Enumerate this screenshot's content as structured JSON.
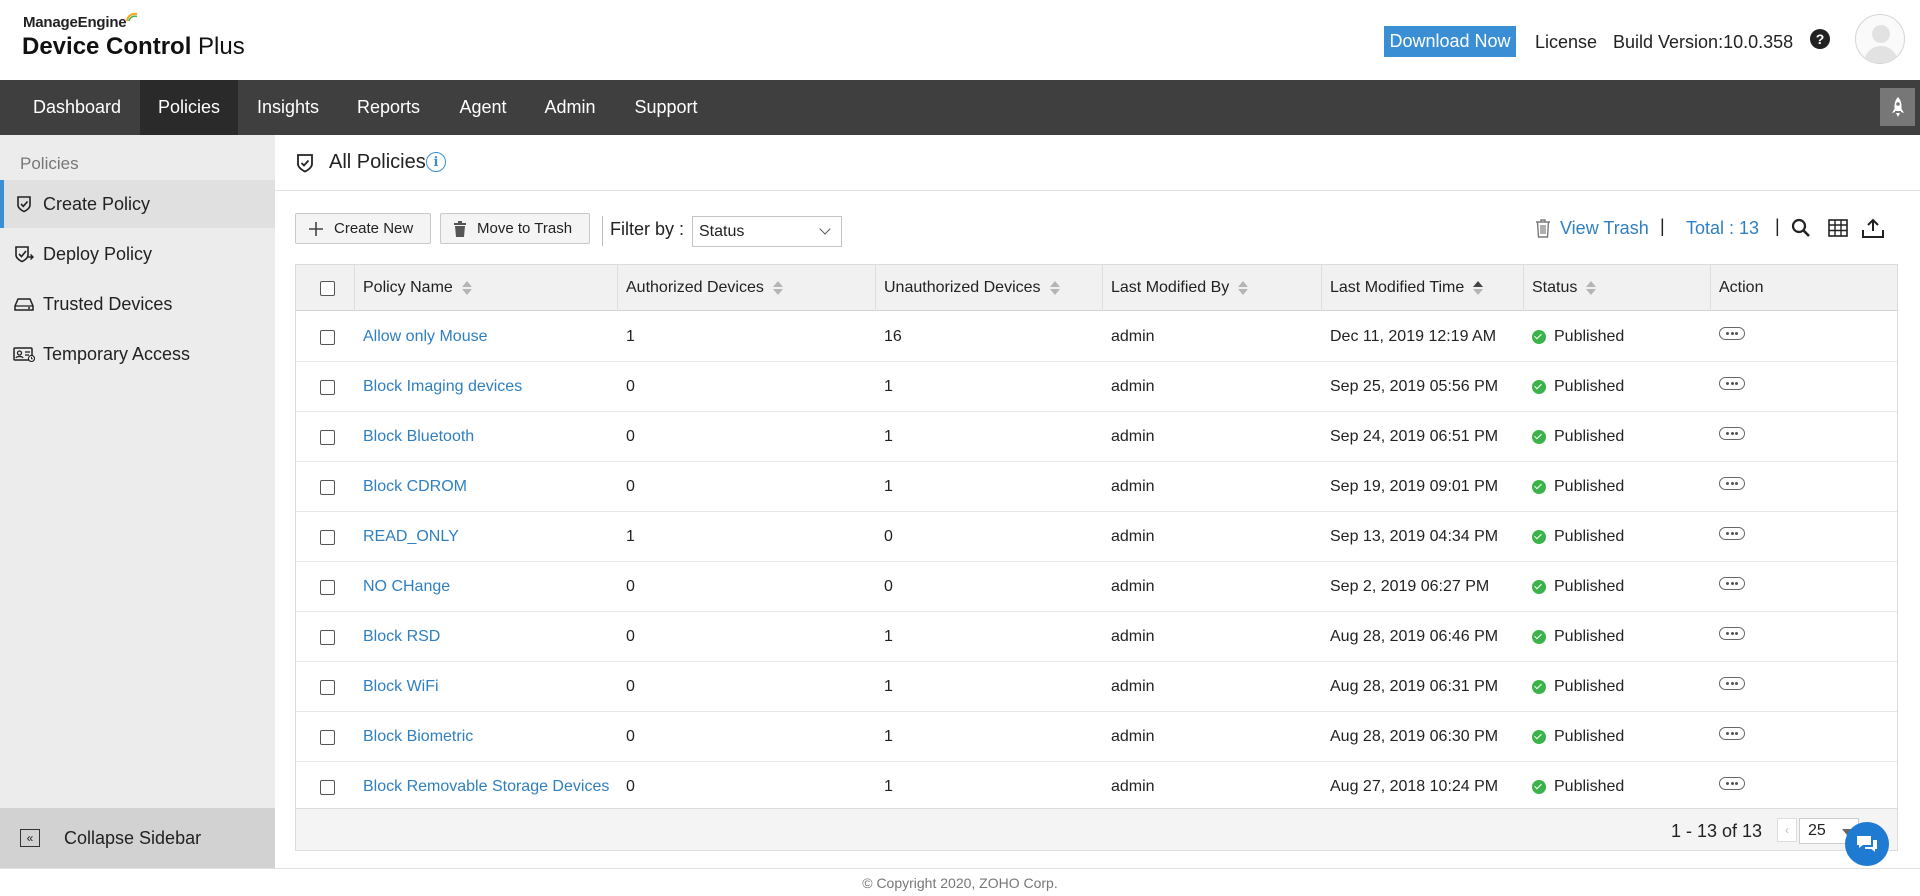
{
  "brand": {
    "top": "ManageEngine",
    "main_bold": "Device Control",
    "main_light": " Plus"
  },
  "header": {
    "download_label": "Download Now",
    "license_label": "License",
    "build_version": "Build Version:10.0.358",
    "help_icon": "question-circle-icon",
    "avatar_icon": "user-avatar-icon"
  },
  "nav": {
    "items": [
      "Dashboard",
      "Policies",
      "Insights",
      "Reports",
      "Agent",
      "Admin",
      "Support"
    ],
    "active": "Policies",
    "rocket_icon": "rocket-icon"
  },
  "sidebar": {
    "title": "Policies",
    "items": [
      {
        "label": "Create Policy",
        "icon": "shield-check-icon"
      },
      {
        "label": "Deploy Policy",
        "icon": "deploy-check-icon"
      },
      {
        "label": "Trusted Devices",
        "icon": "drive-icon"
      },
      {
        "label": "Temporary Access",
        "icon": "access-card-icon"
      }
    ],
    "active": "Create Policy",
    "collapse_label": "Collapse Sidebar"
  },
  "main": {
    "title": "All Policies",
    "create_new_label": "Create New",
    "move_to_trash_label": "Move to Trash",
    "filter_label": "Filter by :",
    "filter_value": "Status",
    "view_trash_label": "View Trash",
    "total_label": "Total : 13",
    "separator": "|"
  },
  "table": {
    "columns": [
      "Policy Name",
      "Authorized Devices",
      "Unauthorized Devices",
      "Last Modified By",
      "Last Modified Time",
      "Status",
      "Action"
    ],
    "rows": [
      [
        "Allow only Mouse",
        "1",
        "16",
        "admin",
        "Dec 11, 2019 12:19 AM",
        "Published"
      ],
      [
        "Block Imaging devices",
        "0",
        "1",
        "admin",
        "Sep 25, 2019 05:56 PM",
        "Published"
      ],
      [
        "Block Bluetooth",
        "0",
        "1",
        "admin",
        "Sep 24, 2019 06:51 PM",
        "Published"
      ],
      [
        "Block CDROM",
        "0",
        "1",
        "admin",
        "Sep 19, 2019 09:01 PM",
        "Published"
      ],
      [
        "READ_ONLY",
        "1",
        "0",
        "admin",
        "Sep 13, 2019 04:34 PM",
        "Published"
      ],
      [
        "NO CHange",
        "0",
        "0",
        "admin",
        "Sep 2, 2019 06:27 PM",
        "Published"
      ],
      [
        "Block RSD",
        "0",
        "1",
        "admin",
        "Aug 28, 2019 06:46 PM",
        "Published"
      ],
      [
        "Block WiFi",
        "0",
        "1",
        "admin",
        "Aug 28, 2019 06:31 PM",
        "Published"
      ],
      [
        "Block Biometric",
        "0",
        "1",
        "admin",
        "Aug 28, 2019 06:30 PM",
        "Published"
      ],
      [
        "Block Removable Storage Devices",
        "0",
        "1",
        "admin",
        "Aug 27, 2018 10:24 PM",
        "Published"
      ]
    ],
    "pagination": {
      "range": "1 - 13 of 13",
      "page_size": "25"
    }
  },
  "footer": {
    "copyright": "© Copyright 2020, ZOHO Corp."
  },
  "colors": {
    "accent": "#3a8fd4",
    "link": "#2f7fc1",
    "nav_bg": "#3f3f3f",
    "status_green": "#3bb34a"
  }
}
